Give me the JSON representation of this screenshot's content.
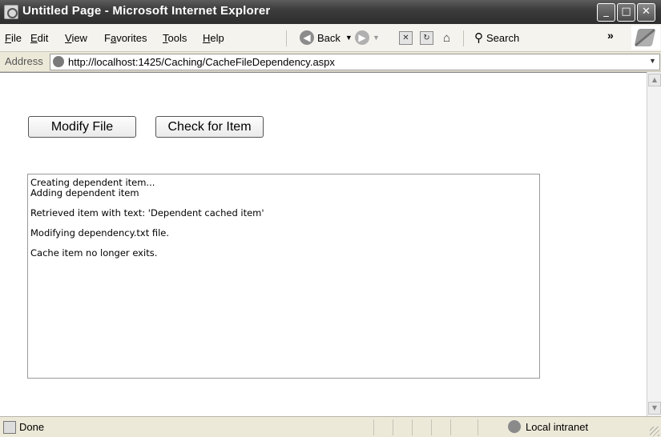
{
  "window": {
    "title": "Untitled Page - Microsoft Internet Explorer",
    "controls": {
      "minimize": "_",
      "maximize": "□",
      "close": "✕"
    }
  },
  "menu": {
    "file": {
      "accel": "F",
      "rest": "ile"
    },
    "edit": {
      "accel": "E",
      "rest": "dit"
    },
    "view": {
      "accel": "V",
      "rest": "iew"
    },
    "favorites": {
      "pre": "F",
      "accel": "a",
      "rest": "vorites"
    },
    "tools": {
      "accel": "T",
      "rest": "ools"
    },
    "help": {
      "accel": "H",
      "rest": "elp"
    }
  },
  "toolbar": {
    "back_label": "Back",
    "search_label": "Search",
    "more": "»",
    "icons": [
      "back-icon",
      "forward-icon",
      "stop-icon",
      "refresh-icon",
      "home-icon",
      "search-icon"
    ]
  },
  "address": {
    "label": "Address",
    "url": "http://localhost:1425/Caching/CacheFileDependency.aspx"
  },
  "page": {
    "modify_button": "Modify File",
    "check_button": "Check for Item",
    "log_lines": [
      "Creating dependent item...",
      "Adding dependent item",
      "",
      "Retrieved item with text: 'Dependent cached item'",
      "",
      "Modifying dependency.txt file.",
      "",
      "Cache item no longer exits."
    ]
  },
  "status": {
    "text": "Done",
    "zone": "Local intranet"
  }
}
